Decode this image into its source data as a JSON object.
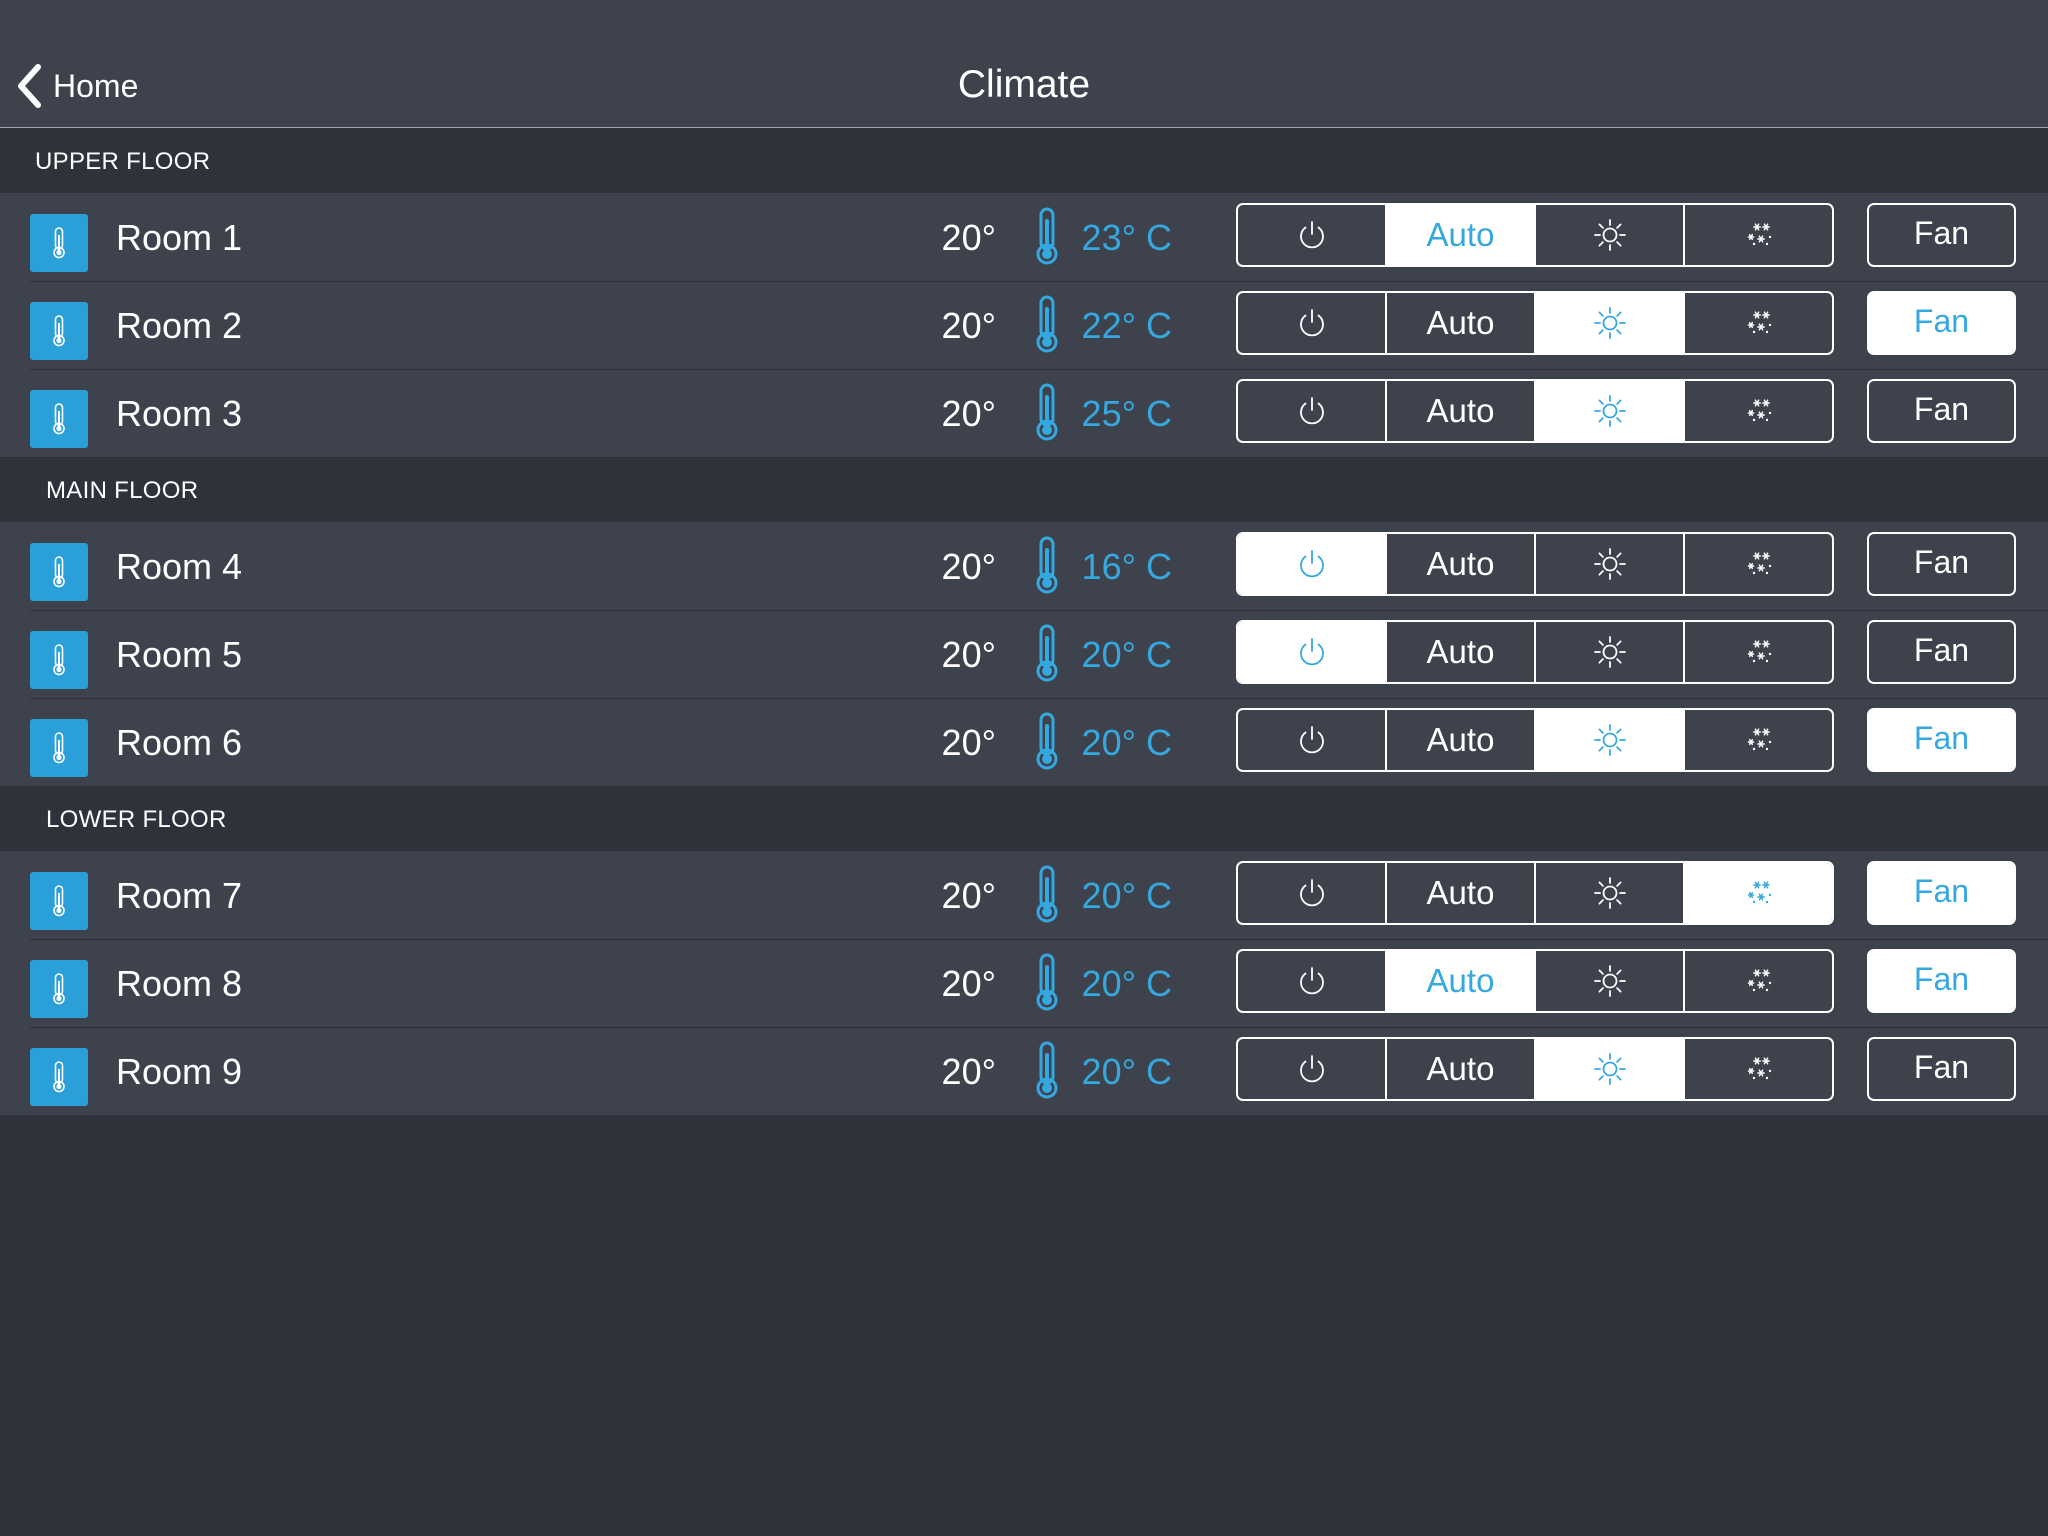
{
  "nav": {
    "back_label": "Home",
    "title": "Climate"
  },
  "colors": {
    "background": "#2e323b",
    "row_background": "#3e424c",
    "accent": "#35a8e0",
    "icon_tile": "#2a9fd8",
    "active_segment": "#ffffff"
  },
  "icons": {
    "back": "chevron-left-icon",
    "room": "thermometer-icon",
    "current_temp": "thermometer-icon",
    "off": "power-icon",
    "heat": "sun-icon",
    "cool": "snowflake-icon"
  },
  "mode_labels": {
    "auto": "Auto"
  },
  "fan_label": "Fan",
  "sections": [
    {
      "title": "UPPER FLOOR",
      "rooms": [
        {
          "name": "Room 1",
          "setpoint": "20°",
          "current": "23° C",
          "mode": "auto",
          "fan_on": false
        },
        {
          "name": "Room 2",
          "setpoint": "20°",
          "current": "22° C",
          "mode": "heat",
          "fan_on": true
        },
        {
          "name": "Room 3",
          "setpoint": "20°",
          "current": "25° C",
          "mode": "heat",
          "fan_on": false
        }
      ]
    },
    {
      "title": "MAIN FLOOR",
      "rooms": [
        {
          "name": "Room 4",
          "setpoint": "20°",
          "current": "16° C",
          "mode": "off",
          "fan_on": false
        },
        {
          "name": "Room 5",
          "setpoint": "20°",
          "current": "20° C",
          "mode": "off",
          "fan_on": false
        },
        {
          "name": "Room 6",
          "setpoint": "20°",
          "current": "20° C",
          "mode": "heat",
          "fan_on": true
        }
      ]
    },
    {
      "title": "LOWER FLOOR",
      "rooms": [
        {
          "name": "Room 7",
          "setpoint": "20°",
          "current": "20° C",
          "mode": "cool",
          "fan_on": true
        },
        {
          "name": "Room 8",
          "setpoint": "20°",
          "current": "20° C",
          "mode": "auto",
          "fan_on": true
        },
        {
          "name": "Room 9",
          "setpoint": "20°",
          "current": "20° C",
          "mode": "heat",
          "fan_on": false
        }
      ]
    }
  ]
}
